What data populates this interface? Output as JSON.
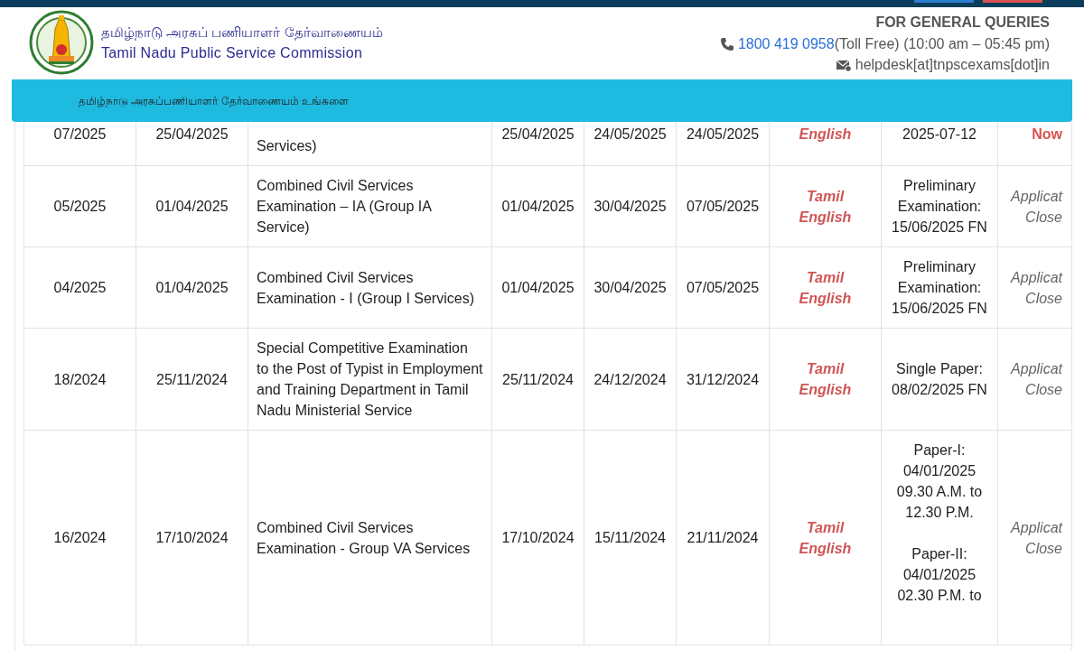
{
  "top_bar": {
    "buttons": [
      {
        "color": "#2f7fd0"
      },
      {
        "color": "#d9534f"
      }
    ]
  },
  "header": {
    "title_tamil": "தமிழ்நாடு அரசுப் பணியாளர் தேர்வாணையம்",
    "title_english": "Tamil Nadu Public Service Commission",
    "queries_heading": "FOR GENERAL QUERIES",
    "phone": "1800 419 0958",
    "phone_note": "(Toll Free) (10:00 am – 05:45 pm)",
    "email": "helpdesk[at]tnpscexams[dot]in"
  },
  "banner": {
    "text": "தமிழ்நாடு அரசுப்பணியாளர் தேர்வாணையம் உங்களை"
  },
  "table": {
    "rows": [
      {
        "number": "07/2025",
        "notification_date": "25/04/2025",
        "title": "Services)",
        "start": "25/04/2025",
        "end": "24/05/2025",
        "last_date": "24/05/2025",
        "languages": [
          "English"
        ],
        "exam_date": [
          "2025-07-12"
        ],
        "status": {
          "kind": "apply",
          "lines": [
            "Now"
          ]
        }
      },
      {
        "number": "05/2025",
        "notification_date": "01/04/2025",
        "title": "Combined Civil Services Examination – IA (Group IA Service)",
        "start": "01/04/2025",
        "end": "30/04/2025",
        "last_date": "07/05/2025",
        "languages": [
          "Tamil",
          "English"
        ],
        "exam_date": [
          "Preliminary\nExamination:\n15/06/2025 FN"
        ],
        "status": {
          "kind": "closed",
          "lines": [
            "Applicat",
            "Close"
          ]
        }
      },
      {
        "number": "04/2025",
        "notification_date": "01/04/2025",
        "title": "Combined Civil Services Examination - I (Group I Services)",
        "start": "01/04/2025",
        "end": "30/04/2025",
        "last_date": "07/05/2025",
        "languages": [
          "Tamil",
          "English"
        ],
        "exam_date": [
          "Preliminary\nExamination:\n15/06/2025 FN"
        ],
        "status": {
          "kind": "closed",
          "lines": [
            "Applicat",
            "Close"
          ]
        }
      },
      {
        "number": "18/2024",
        "notification_date": "25/11/2024",
        "title": "Special Competitive Examination to the Post of Typist in Employment and Training Department in Tamil Nadu Ministerial Service",
        "start": "25/11/2024",
        "end": "24/12/2024",
        "last_date": "31/12/2024",
        "languages": [
          "Tamil",
          "English"
        ],
        "exam_date": [
          "Single Paper:\n08/02/2025 FN"
        ],
        "status": {
          "kind": "closed",
          "lines": [
            "Applicat",
            "Close"
          ]
        }
      },
      {
        "number": "16/2024",
        "notification_date": "17/10/2024",
        "title": "Combined Civil Services Examination - Group VA Services",
        "start": "17/10/2024",
        "end": "15/11/2024",
        "last_date": "21/11/2024",
        "languages": [
          "Tamil",
          "English"
        ],
        "exam_date": [
          "Paper-I:\n04/01/2025\n09.30 A.M. to\n12.30 P.M.",
          "Paper-II:\n04/01/2025\n02.30 P.M. to"
        ],
        "status": {
          "kind": "closed",
          "lines": [
            "Applicat",
            "Close"
          ]
        }
      }
    ]
  }
}
